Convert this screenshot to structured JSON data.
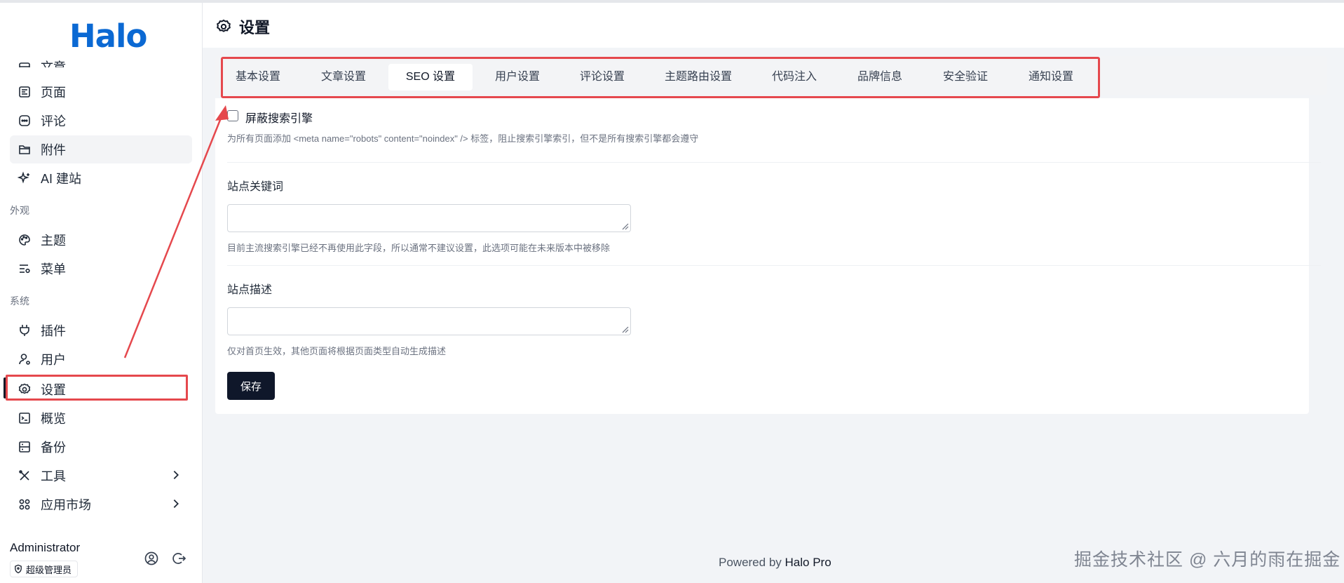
{
  "app": {
    "logo_text": "Halo"
  },
  "sidebar": {
    "partial_item": "文章",
    "items": [
      {
        "label": "页面",
        "icon": "page-icon"
      },
      {
        "label": "评论",
        "icon": "comment-icon"
      },
      {
        "label": "附件",
        "icon": "folder-icon"
      },
      {
        "label": "AI 建站",
        "icon": "sparkle-icon"
      }
    ],
    "group_appearance": "外观",
    "appearance_items": [
      {
        "label": "主题",
        "icon": "palette-icon"
      },
      {
        "label": "菜单",
        "icon": "menu-icon"
      }
    ],
    "group_system": "系统",
    "system_items": [
      {
        "label": "插件",
        "icon": "plug-icon"
      },
      {
        "label": "用户",
        "icon": "user-icon"
      },
      {
        "label": "设置",
        "icon": "gear-icon"
      },
      {
        "label": "概览",
        "icon": "terminal-icon"
      },
      {
        "label": "备份",
        "icon": "database-icon"
      },
      {
        "label": "工具",
        "icon": "tools-icon"
      },
      {
        "label": "应用市场",
        "icon": "apps-icon"
      }
    ]
  },
  "user": {
    "name": "Administrator",
    "role": "超级管理员"
  },
  "header": {
    "title": "设置"
  },
  "tabs": [
    {
      "label": "基本设置"
    },
    {
      "label": "文章设置"
    },
    {
      "label": "SEO 设置",
      "active": true
    },
    {
      "label": "用户设置"
    },
    {
      "label": "评论设置"
    },
    {
      "label": "主题路由设置"
    },
    {
      "label": "代码注入"
    },
    {
      "label": "品牌信息"
    },
    {
      "label": "安全验证"
    },
    {
      "label": "通知设置"
    }
  ],
  "form": {
    "block_search_label": "屏蔽搜索引擎",
    "block_search_checked": false,
    "block_search_help": "为所有页面添加 <meta name=\"robots\" content=\"noindex\" /> 标签，阻止搜索引擎索引，但不是所有搜索引擎都会遵守",
    "keywords_label": "站点关键词",
    "keywords_value": "",
    "keywords_help": "目前主流搜索引擎已经不再使用此字段，所以通常不建议设置，此选项可能在未来版本中被移除",
    "description_label": "站点描述",
    "description_value": "",
    "description_help": "仅对首页生效，其他页面将根据页面类型自动生成描述",
    "save_label": "保存"
  },
  "footer": {
    "prefix": "Powered by",
    "brand": "Halo Pro"
  },
  "watermark": "掘金技术社区 @ 六月的雨在掘金",
  "colors": {
    "brand": "#0b69d3",
    "highlight": "#e5484d",
    "save_button": "#0f172a"
  }
}
